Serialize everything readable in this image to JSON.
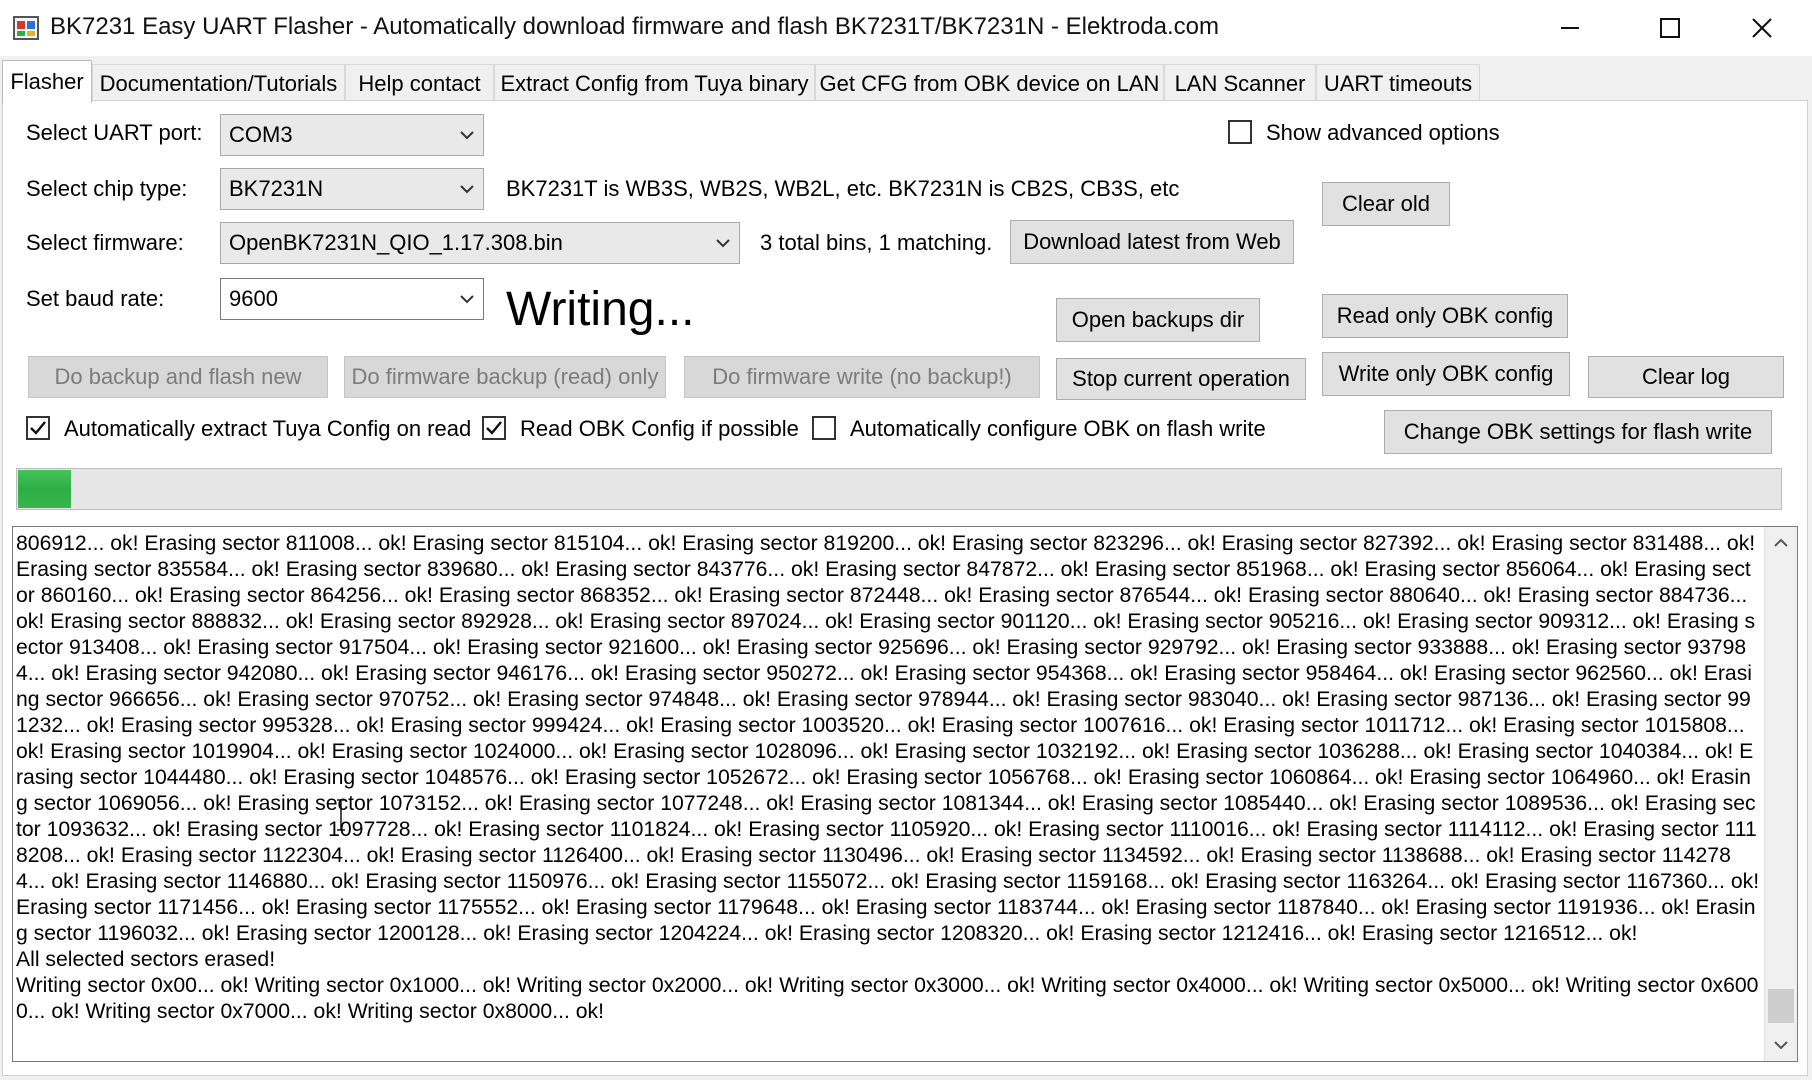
{
  "window": {
    "title": "BK7231 Easy UART Flasher - Automatically download firmware and flash BK7231T/BK7231N  - Elektroda.com",
    "minimize": "—",
    "maximize": "☐",
    "close": "✕"
  },
  "tabs": [
    {
      "label": "Flasher",
      "active": true
    },
    {
      "label": "Documentation/Tutorials"
    },
    {
      "label": "Help contact"
    },
    {
      "label": "Extract Config from Tuya binary"
    },
    {
      "label": "Get CFG from OBK device on LAN"
    },
    {
      "label": "LAN Scanner"
    },
    {
      "label": "UART timeouts"
    }
  ],
  "form": {
    "uart_label": "Select UART port:",
    "uart_value": "COM3",
    "chip_label": "Select chip type:",
    "chip_value": "BK7231N",
    "chip_hint": "BK7231T is WB3S, WB2S, WB2L, etc. BK7231N is CB2S, CB3S, etc",
    "fw_label": "Select firmware:",
    "fw_value": "OpenBK7231N_QIO_1.17.308.bin",
    "fw_info": "3 total bins, 1 matching.",
    "baud_label": "Set baud rate:",
    "baud_value": "9600",
    "status": "Writing...",
    "advanced_label": "Show advanced options",
    "advanced_checked": false
  },
  "buttons": {
    "clear_old": "Clear old",
    "download_latest": "Download latest from Web",
    "open_backups": "Open backups dir",
    "read_obk": "Read only OBK config",
    "backup_flash": "Do backup and flash new",
    "fw_backup": "Do firmware backup (read) only",
    "fw_write": "Do firmware write (no backup!)",
    "stop": "Stop current operation",
    "write_obk": "Write only OBK config",
    "clear_log": "Clear log",
    "change_obk": "Change OBK settings for flash write"
  },
  "options": {
    "extract_tuya": {
      "label": "Automatically extract Tuya Config on read",
      "checked": true
    },
    "read_obk": {
      "label": "Read OBK Config if possible",
      "checked": true
    },
    "auto_config": {
      "label": "Automatically configure OBK on flash write",
      "checked": false
    }
  },
  "progress": {
    "fraction": 0.03
  },
  "log": {
    "text": "806912... ok! Erasing sector 811008... ok! Erasing sector 815104... ok! Erasing sector 819200... ok! Erasing sector 823296... ok! Erasing sector 827392... ok! Erasing sector 831488... ok! Erasing sector 835584... ok! Erasing sector 839680... ok! Erasing sector 843776... ok! Erasing sector 847872... ok! Erasing sector 851968... ok! Erasing sector 856064... ok! Erasing sector 860160... ok! Erasing sector 864256... ok! Erasing sector 868352... ok! Erasing sector 872448... ok! Erasing sector 876544... ok! Erasing sector 880640... ok! Erasing sector 884736... ok! Erasing sector 888832... ok! Erasing sector 892928... ok! Erasing sector 897024... ok! Erasing sector 901120... ok! Erasing sector 905216... ok! Erasing sector 909312... ok! Erasing sector 913408... ok! Erasing sector 917504... ok! Erasing sector 921600... ok! Erasing sector 925696... ok! Erasing sector 929792... ok! Erasing sector 933888... ok! Erasing sector 937984... ok! Erasing sector 942080... ok! Erasing sector 946176... ok! Erasing sector 950272... ok! Erasing sector 954368... ok! Erasing sector 958464... ok! Erasing sector 962560... ok! Erasing sector 966656... ok! Erasing sector 970752... ok! Erasing sector 974848... ok! Erasing sector 978944... ok! Erasing sector 983040... ok! Erasing sector 987136... ok! Erasing sector 991232... ok! Erasing sector 995328... ok! Erasing sector 999424... ok! Erasing sector 1003520... ok! Erasing sector 1007616... ok! Erasing sector 1011712... ok! Erasing sector 1015808... ok! Erasing sector 1019904... ok! Erasing sector 1024000... ok! Erasing sector 1028096... ok! Erasing sector 1032192... ok! Erasing sector 1036288... ok! Erasing sector 1040384... ok! Erasing sector 1044480... ok! Erasing sector 1048576... ok! Erasing sector 1052672... ok! Erasing sector 1056768... ok! Erasing sector 1060864... ok! Erasing sector 1064960... ok! Erasing sector 1069056... ok! Erasing sector 1073152... ok! Erasing sector 1077248... ok! Erasing sector 1081344... ok! Erasing sector 1085440... ok! Erasing sector 1089536... ok! Erasing sector 1093632... ok! Erasing sector 1097728... ok! Erasing sector 1101824... ok! Erasing sector 1105920... ok! Erasing sector 1110016... ok! Erasing sector 1114112... ok! Erasing sector 1118208... ok! Erasing sector 1122304... ok! Erasing sector 1126400... ok! Erasing sector 1130496... ok! Erasing sector 1134592... ok! Erasing sector 1138688... ok! Erasing sector 1142784... ok! Erasing sector 1146880... ok! Erasing sector 1150976... ok! Erasing sector 1155072... ok! Erasing sector 1159168... ok! Erasing sector 1163264... ok! Erasing sector 1167360... ok! Erasing sector 1171456... ok! Erasing sector 1175552... ok! Erasing sector 1179648... ok! Erasing sector 1183744... ok! Erasing sector 1187840... ok! Erasing sector 1191936... ok! Erasing sector 1196032... ok! Erasing sector 1200128... ok! Erasing sector 1204224... ok! Erasing sector 1208320... ok! Erasing sector 1212416... ok! Erasing sector 1216512... ok!\nAll selected sectors erased!\nWriting sector 0x00... ok! Writing sector 0x1000... ok! Writing sector 0x2000... ok! Writing sector 0x3000... ok! Writing sector 0x4000... ok! Writing sector 0x5000... ok! Writing sector 0x6000... ok! Writing sector 0x7000... ok! Writing sector 0x8000... ok!"
  },
  "colors": {
    "progress_fill": "#2eae46",
    "panel_bg": "#ffffff",
    "window_bg": "#f0f0f0"
  }
}
